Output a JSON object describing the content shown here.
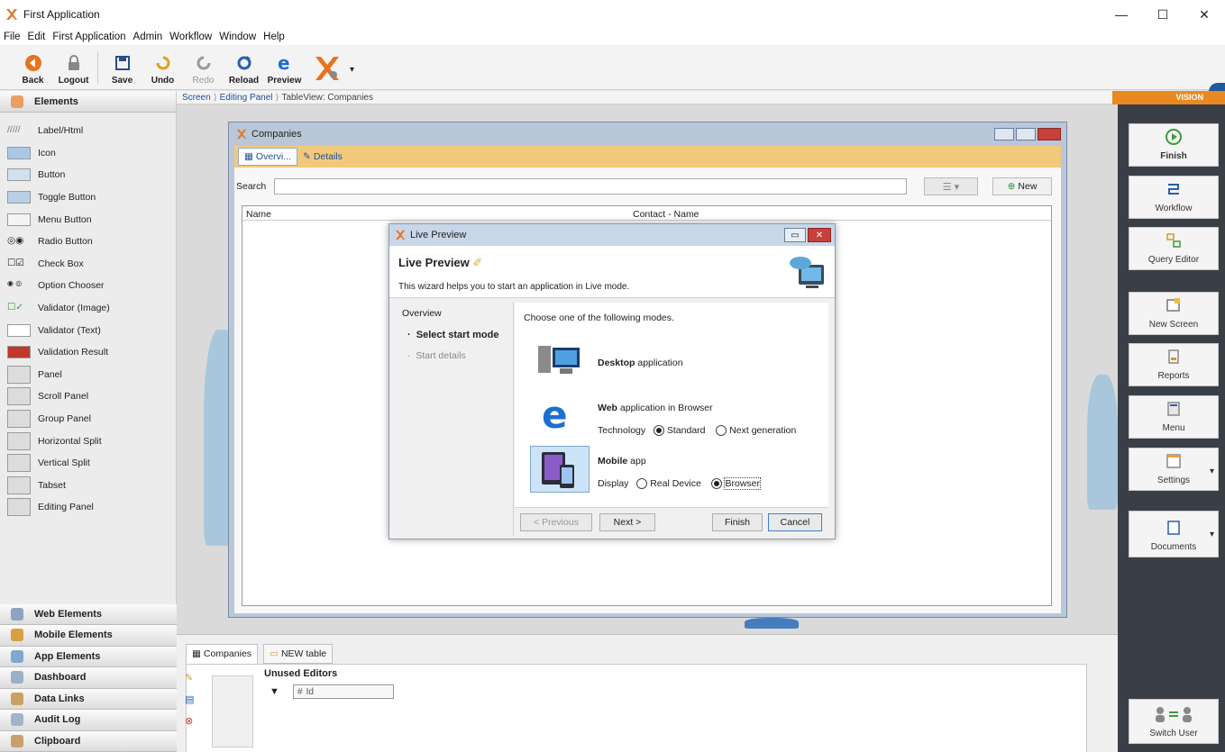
{
  "window": {
    "title": "First Application",
    "controls": [
      "—",
      "☐",
      "✕"
    ]
  },
  "menu": [
    "File",
    "Edit",
    "First Application",
    "Admin",
    "Workflow",
    "Window",
    "Help"
  ],
  "toolbar": {
    "buttons": [
      {
        "label": "Back",
        "icon": "back-icon",
        "enabled": true
      },
      {
        "label": "Logout",
        "icon": "logout-icon",
        "enabled": true
      },
      {
        "label": "Save",
        "icon": "save-icon",
        "enabled": true
      },
      {
        "label": "Undo",
        "icon": "undo-icon",
        "enabled": true
      },
      {
        "label": "Redo",
        "icon": "redo-icon",
        "enabled": false
      },
      {
        "label": "Reload",
        "icon": "reload-icon",
        "enabled": true
      },
      {
        "label": "Preview",
        "icon": "preview-icon",
        "enabled": true
      }
    ]
  },
  "left_panel": {
    "header": "Elements",
    "elements": [
      "Label/Html",
      "Icon",
      "Button",
      "Toggle Button",
      "Menu Button",
      "Radio Button",
      "Check Box",
      "Option Chooser",
      "Validator (Image)",
      "Validator (Text)",
      "Validation Result",
      "Panel",
      "Scroll Panel",
      "Group Panel",
      "Horizontal Split",
      "Vertical Split",
      "Tabset",
      "Editing Panel"
    ],
    "sections": [
      "Web Elements",
      "Mobile Elements",
      "App Elements",
      "Dashboard",
      "Data Links",
      "Audit Log",
      "Clipboard"
    ]
  },
  "breadcrumb": {
    "items": [
      "Screen",
      "Editing Panel"
    ],
    "current": "TableView: Companies"
  },
  "companies_window": {
    "title": "Companies",
    "tabs": [
      "Overvi...",
      "Details"
    ],
    "search_label": "Search",
    "new_button": "New",
    "columns": [
      "Name",
      "Contact - Name"
    ]
  },
  "live_preview_dialog": {
    "title": "Live Preview",
    "heading": "Live Preview",
    "description": "This wizard helps you to start an application in Live mode.",
    "steps": {
      "overview": "Overview",
      "current": "Select start mode",
      "next": "Start details"
    },
    "instruction": "Choose one of the following modes.",
    "desktop": {
      "bold": "Desktop",
      "rest": " application"
    },
    "web": {
      "bold": "Web",
      "rest": " application in Browser",
      "tech_label": "Technology",
      "option_standard": "Standard",
      "option_next": "Next generation",
      "selected": "Standard"
    },
    "mobile": {
      "bold": "Mobile",
      "rest": " app",
      "display_label": "Display",
      "option_device": "Real Device",
      "option_browser": "Browser",
      "selected": "Browser"
    },
    "buttons": {
      "previous": "< Previous",
      "next": "Next >",
      "finish": "Finish",
      "cancel": "Cancel"
    }
  },
  "bottom_panel": {
    "tabs": [
      "Companies",
      "NEW table"
    ],
    "unused_editors_label": "Unused Editors",
    "field": "Id"
  },
  "right_panel": {
    "brand": "VISION",
    "buttons": [
      "Finish",
      "Workflow",
      "Query Editor",
      "New Screen",
      "Reports",
      "Menu",
      "Settings",
      "Documents",
      "Switch User"
    ]
  },
  "colors": {
    "accent_orange": "#e88a21",
    "right_panel_bg": "#3a3f47",
    "link_blue": "#1b4f95",
    "tabs_band": "#f2c97b"
  }
}
